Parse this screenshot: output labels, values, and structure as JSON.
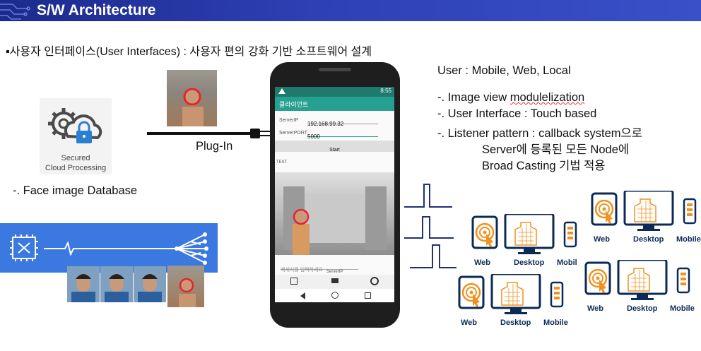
{
  "slide": {
    "title": "S/W Architecture",
    "subtitle": "▪사용자 인터페이스(User Interfaces) : 사용자 편의 강화 기반 소프트웨어 설계"
  },
  "left": {
    "cloud_label_line1": "Secured",
    "cloud_label_line2": "Cloud Processing",
    "db_label": "-. Face image Database",
    "plugin_label": "Plug-In"
  },
  "phone": {
    "status_time": "8:55",
    "app_title": "클라이언트",
    "server_ip_label": "ServerIP",
    "server_ip_value": "192.168.99.32",
    "server_port_label": "ServerPORT",
    "server_port_value": "5000",
    "start_label": "Start",
    "test_label": "TEST",
    "message_placeholder": "메세지를 입력하세요",
    "bottom_small_label": "ServerIP"
  },
  "right": {
    "user_line": "User : Mobile, Web, Local",
    "feature1_prefix": "-. Image view ",
    "feature1_underlined": "modulelization",
    "feature2": "-. User Interface : Touch based",
    "feature3": "-. Listener pattern : callback system으로",
    "feature3_cont1": "Server에 등록된 모든 Node에",
    "feature3_cont2": "Broad Casting 기법 적용"
  },
  "devices": {
    "web": "Web",
    "desktop": "Desktop",
    "mobile": "Mobile",
    "mobile_cut": "Mobil"
  },
  "colors": {
    "title_bar": "#2e40b5",
    "banner_blue": "#3b78e0",
    "device_dark": "#0b2a55",
    "device_orange": "#f2911b",
    "pulse_line": "#1f2f7a",
    "face_marker": "#e8232b"
  }
}
